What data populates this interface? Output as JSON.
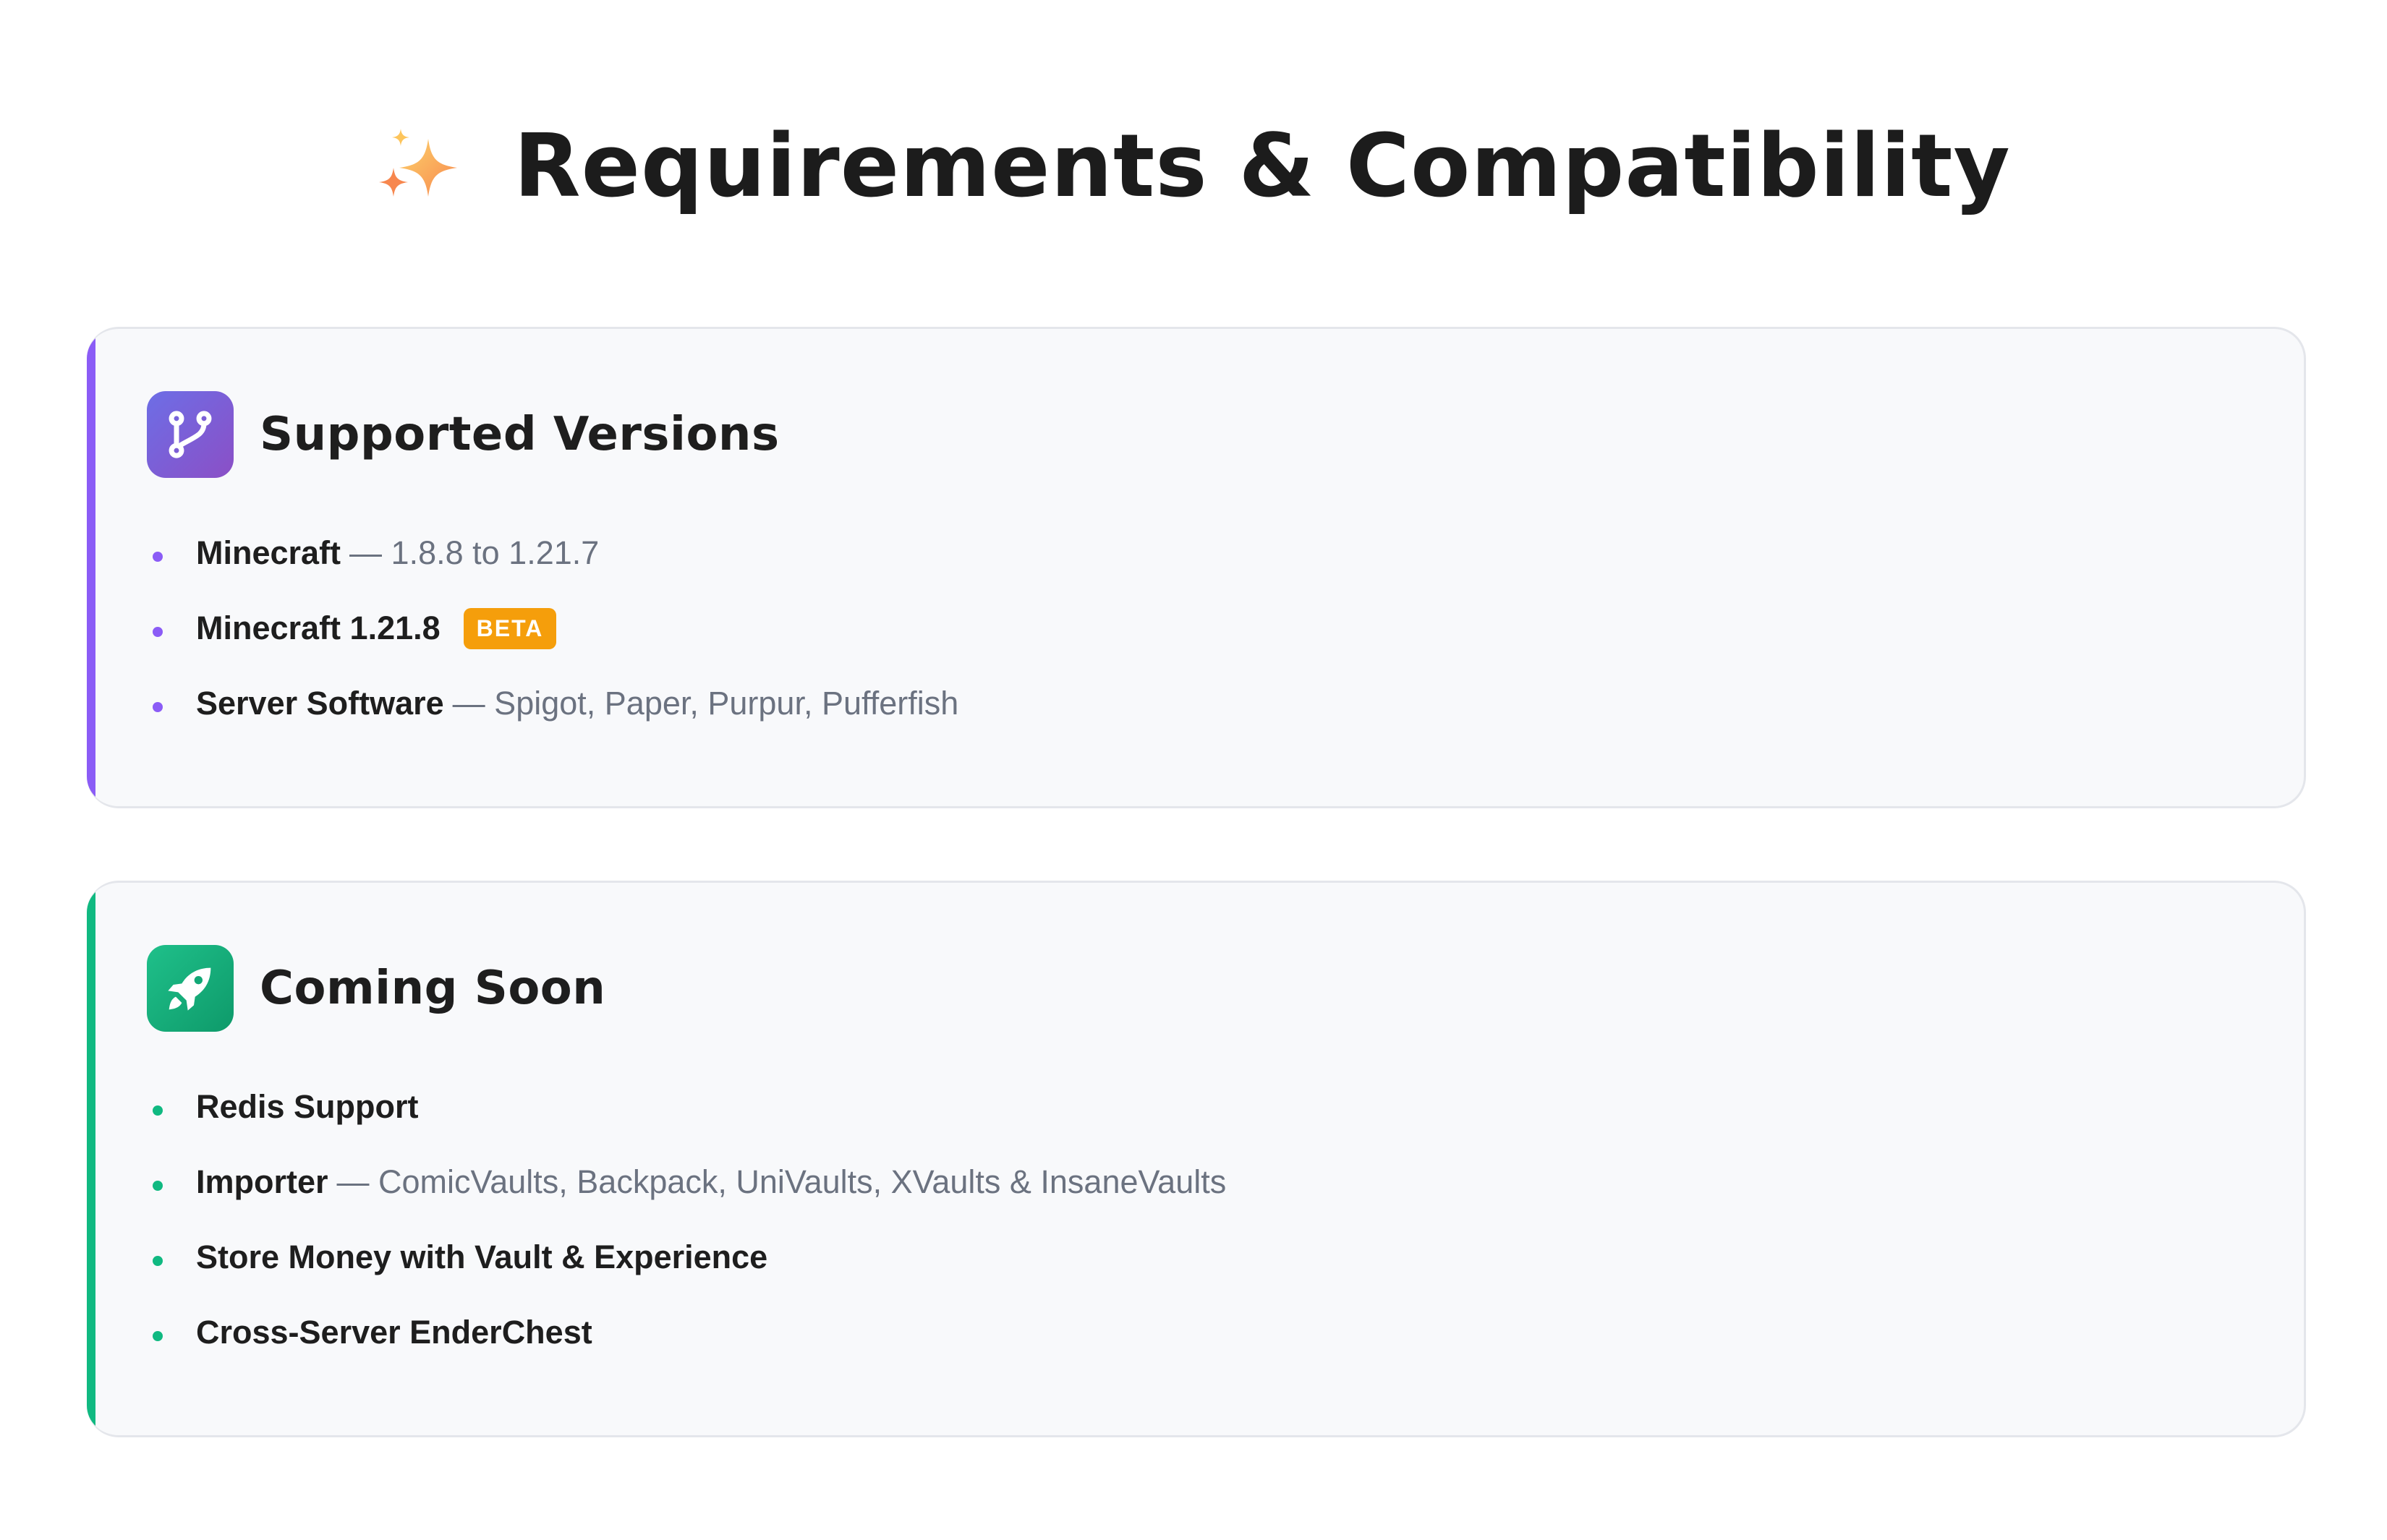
{
  "header": {
    "title": "Requirements & Compatibility",
    "icon": "sparkles-icon"
  },
  "colors": {
    "versions_accent": "#8b5cf6",
    "soon_accent": "#10b981",
    "badge": "#f59e0b",
    "detail_text": "#6b7280"
  },
  "supported_versions": {
    "title": "Supported Versions",
    "icon": "git-branch-icon",
    "items": [
      {
        "label": "Minecraft",
        "detail": "— 1.8.8 to 1.21.7"
      },
      {
        "label": "Minecraft 1.21.8",
        "badge": "BETA"
      },
      {
        "label": "Server Software",
        "detail": "— Spigot, Paper, Purpur, Pufferfish"
      }
    ]
  },
  "coming_soon": {
    "title": "Coming Soon",
    "icon": "rocket-icon",
    "items": [
      {
        "label": "Redis Support"
      },
      {
        "label": "Importer",
        "detail": "— ComicVaults, Backpack, UniVaults, XVaults & InsaneVaults"
      },
      {
        "label": "Store Money with Vault & Experience"
      },
      {
        "label": "Cross-Server EnderChest"
      }
    ]
  }
}
